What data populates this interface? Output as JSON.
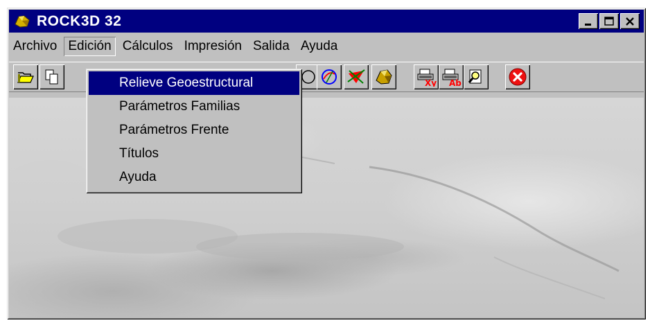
{
  "window": {
    "title": "ROCK3D 32",
    "controls": {
      "minimize": "_",
      "maximize": "□",
      "close": "✕"
    }
  },
  "menubar": {
    "items": [
      "Archivo",
      "Edición",
      "Cálculos",
      "Impresión",
      "Salida",
      "Ayuda"
    ],
    "active": "Edición"
  },
  "dropdown": {
    "items": [
      "Relieve Geoestructural",
      "Parámetros Familias",
      "Parámetros Frente",
      "Títulos",
      "Ayuda"
    ],
    "selected": "Relieve Geoestructural"
  },
  "toolbar": {
    "buttons": [
      {
        "name": "open-icon"
      },
      {
        "name": "copy-icon"
      },
      {
        "name": "sphere-icon"
      },
      {
        "name": "stereonet-icon"
      },
      {
        "name": "wedge-icon"
      },
      {
        "name": "rock-block-icon"
      },
      {
        "name": "print-xy-icon",
        "label": "Xy"
      },
      {
        "name": "print-ab-icon",
        "label": "Ab"
      },
      {
        "name": "preview-icon"
      },
      {
        "name": "exit-icon"
      }
    ]
  },
  "colors": {
    "titlebar": "#000080",
    "face": "#c0c0c0",
    "highlight": "#000080"
  }
}
